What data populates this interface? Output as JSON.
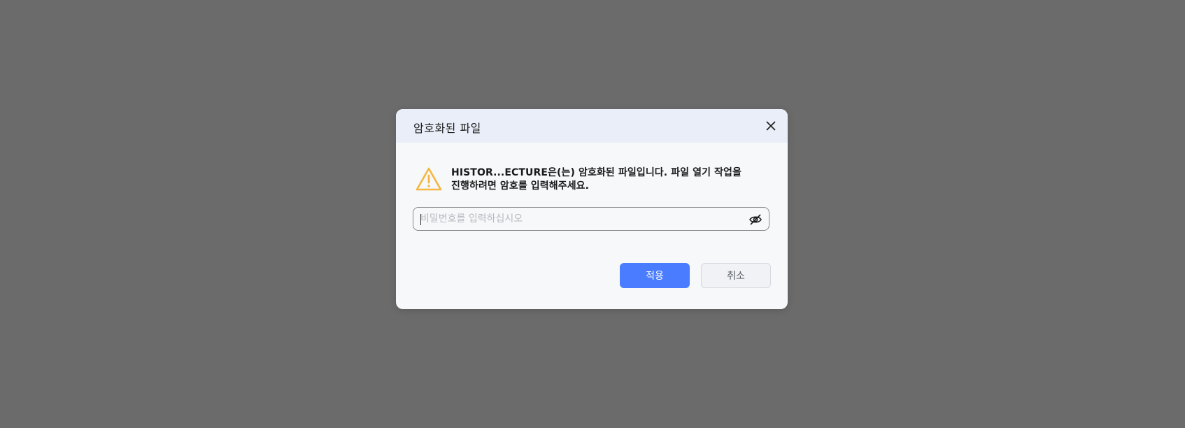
{
  "dialog": {
    "title": "암호화된 파일",
    "message_line1": "HISTOR...ECTURE은(는) 암호화된 파일입니다. 파일 열기 작업을",
    "message_line2": "진행하려면 암호를 입력해주세요.",
    "password": {
      "value": "",
      "placeholder": "비밀번호를 입력하십시오"
    },
    "apply_label": "적용",
    "cancel_label": "취소",
    "icons": {
      "warning": "warning-triangle-icon",
      "close": "close-icon",
      "visibility": "eye-off-icon"
    }
  },
  "colors": {
    "overlay": "#6b6b6b",
    "dialog_bg": "#f7f8fa",
    "header_bg": "#eaeef8",
    "primary": "#4a7cff",
    "warning": "#f5b642"
  }
}
